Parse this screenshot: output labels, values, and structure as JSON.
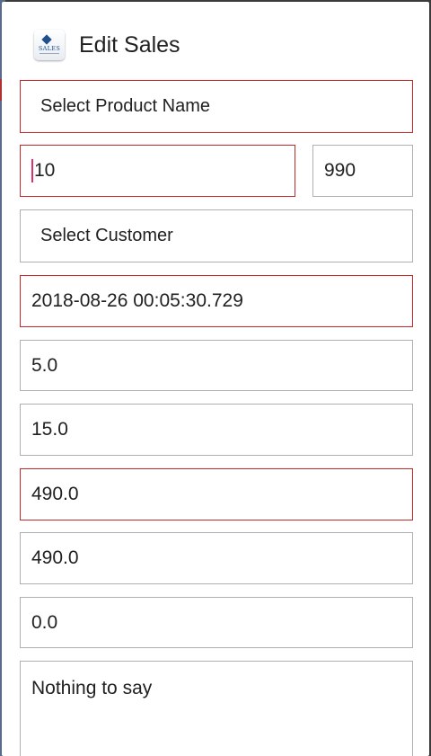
{
  "dialog": {
    "title": "Edit Sales",
    "logo_text": "SALES"
  },
  "form": {
    "product_placeholder": "Select Product Name",
    "quantity": "10",
    "price": "990",
    "customer_placeholder": "Select Customer",
    "date": "2018-08-26 00:05:30.729",
    "field_5": "5.0",
    "field_15": "15.0",
    "field_490a": "490.0",
    "field_490b": "490.0",
    "field_0": "0.0",
    "notes": "Nothing to say"
  },
  "colors": {
    "error_border": "#c62828",
    "normal_border": "#b0b0b0",
    "cursor": "#e0306b",
    "brand": "#1f4f8f"
  }
}
